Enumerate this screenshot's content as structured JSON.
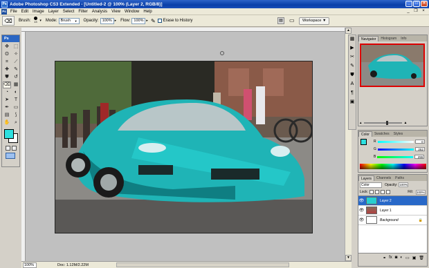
{
  "title_bar": {
    "title": "Adobe Photoshop CS3 Extended - [Untitled-2 @ 100% (Layer 2, RGB/8)]"
  },
  "menu": [
    "File",
    "Edit",
    "Image",
    "Layer",
    "Select",
    "Filter",
    "Analysis",
    "View",
    "Window",
    "Help"
  ],
  "options_bar": {
    "brush_label": "Brush:",
    "brush_size": "13",
    "mode_label": "Mode:",
    "mode_value": "Brush",
    "opacity_label": "Opacity:",
    "opacity_value": "100%",
    "flow_label": "Flow:",
    "flow_value": "100%",
    "erase_history_label": "Erase to History",
    "workspace_label": "Workspace"
  },
  "toolbox": {
    "header": "Ps"
  },
  "colors": {
    "foreground": "#2ee0e0",
    "background": "#ffffff",
    "accent": "#2868c8"
  },
  "status_bar": {
    "zoom": "100%",
    "doc": "Doc: 1.12M/2.22M"
  },
  "navigator": {
    "tabs": [
      "Navigator",
      "Histogram",
      "Info"
    ]
  },
  "color_panel": {
    "tabs": [
      "Color",
      "Swatches",
      "Styles"
    ],
    "r": "0",
    "g": "252",
    "b": "255"
  },
  "layers_panel": {
    "tabs": [
      "Layers",
      "Channels",
      "Paths"
    ],
    "blend_mode": "Color",
    "opacity_label": "Opacity:",
    "opacity_value": "100%",
    "lock_label": "Lock:",
    "fill_label": "Fill:",
    "fill_value": "100%",
    "layers": [
      {
        "name": "Layer 2"
      },
      {
        "name": "Layer 1"
      },
      {
        "name": "Background"
      }
    ]
  }
}
